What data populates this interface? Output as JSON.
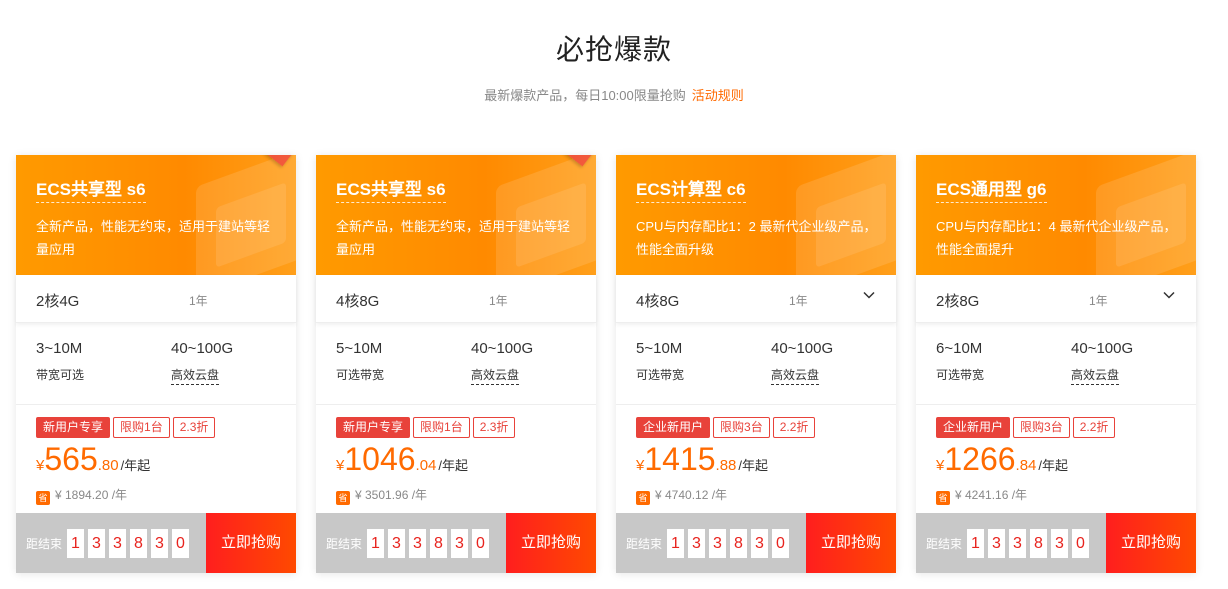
{
  "section": {
    "title": "必抢爆款",
    "subtitle": "最新爆款产品，每日10:00限量抢购",
    "rules_link": "活动规则"
  },
  "colors": {
    "accent": "#ff6a00",
    "header_orange": "#ff9a00",
    "tag_red": "#e8423a",
    "buy_red": "#ff1e1e"
  },
  "cards": [
    {
      "title": "ECS共享型 s6",
      "desc": "全新产品，性能无约束，适用于建站等轻量应用",
      "ribbon": true,
      "cpu_mem": "2核4G",
      "period": "1年",
      "has_dropdown": false,
      "bandwidth": "3~10M",
      "bandwidth_label": "带宽可选",
      "disk": "40~100G",
      "disk_label": "高效云盘",
      "tags": [
        "新用户专享",
        "限购1台",
        "2.3折"
      ],
      "price_yen": "¥",
      "price_int": "565",
      "price_dec": ".80",
      "price_unit": "/年起",
      "save_icon": "省",
      "original_price": "¥ 1894.20 /年",
      "countdown_label": "距结束",
      "countdown": [
        "1",
        "3",
        "3",
        "8",
        "3",
        "0"
      ],
      "buy_label": "立即抢购"
    },
    {
      "title": "ECS共享型 s6",
      "desc": "全新产品，性能无约束，适用于建站等轻量应用",
      "ribbon": true,
      "cpu_mem": "4核8G",
      "period": "1年",
      "has_dropdown": false,
      "bandwidth": "5~10M",
      "bandwidth_label": "可选带宽",
      "disk": "40~100G",
      "disk_label": "高效云盘",
      "tags": [
        "新用户专享",
        "限购1台",
        "2.3折"
      ],
      "price_yen": "¥",
      "price_int": "1046",
      "price_dec": ".04",
      "price_unit": "/年起",
      "save_icon": "省",
      "original_price": "¥ 3501.96 /年",
      "countdown_label": "距结束",
      "countdown": [
        "1",
        "3",
        "3",
        "8",
        "3",
        "0"
      ],
      "buy_label": "立即抢购"
    },
    {
      "title": "ECS计算型 c6",
      "desc": "CPU与内存配比1：2 最新代企业级产品，性能全面升级",
      "ribbon": false,
      "cpu_mem": "4核8G",
      "period": "1年",
      "has_dropdown": true,
      "bandwidth": "5~10M",
      "bandwidth_label": "可选带宽",
      "disk": "40~100G",
      "disk_label": "高效云盘",
      "tags": [
        "企业新用户",
        "限购3台",
        "2.2折"
      ],
      "price_yen": "¥",
      "price_int": "1415",
      "price_dec": ".88",
      "price_unit": "/年起",
      "save_icon": "省",
      "original_price": "¥ 4740.12 /年",
      "countdown_label": "距结束",
      "countdown": [
        "1",
        "3",
        "3",
        "8",
        "3",
        "0"
      ],
      "buy_label": "立即抢购"
    },
    {
      "title": "ECS通用型 g6",
      "desc": "CPU与内存配比1：4 最新代企业级产品，性能全面提升",
      "ribbon": false,
      "cpu_mem": "2核8G",
      "period": "1年",
      "has_dropdown": true,
      "bandwidth": "6~10M",
      "bandwidth_label": "可选带宽",
      "disk": "40~100G",
      "disk_label": "高效云盘",
      "tags": [
        "企业新用户",
        "限购3台",
        "2.2折"
      ],
      "price_yen": "¥",
      "price_int": "1266",
      "price_dec": ".84",
      "price_unit": "/年起",
      "save_icon": "省",
      "original_price": "¥ 4241.16 /年",
      "countdown_label": "距结束",
      "countdown": [
        "1",
        "3",
        "3",
        "8",
        "3",
        "0"
      ],
      "buy_label": "立即抢购"
    }
  ]
}
